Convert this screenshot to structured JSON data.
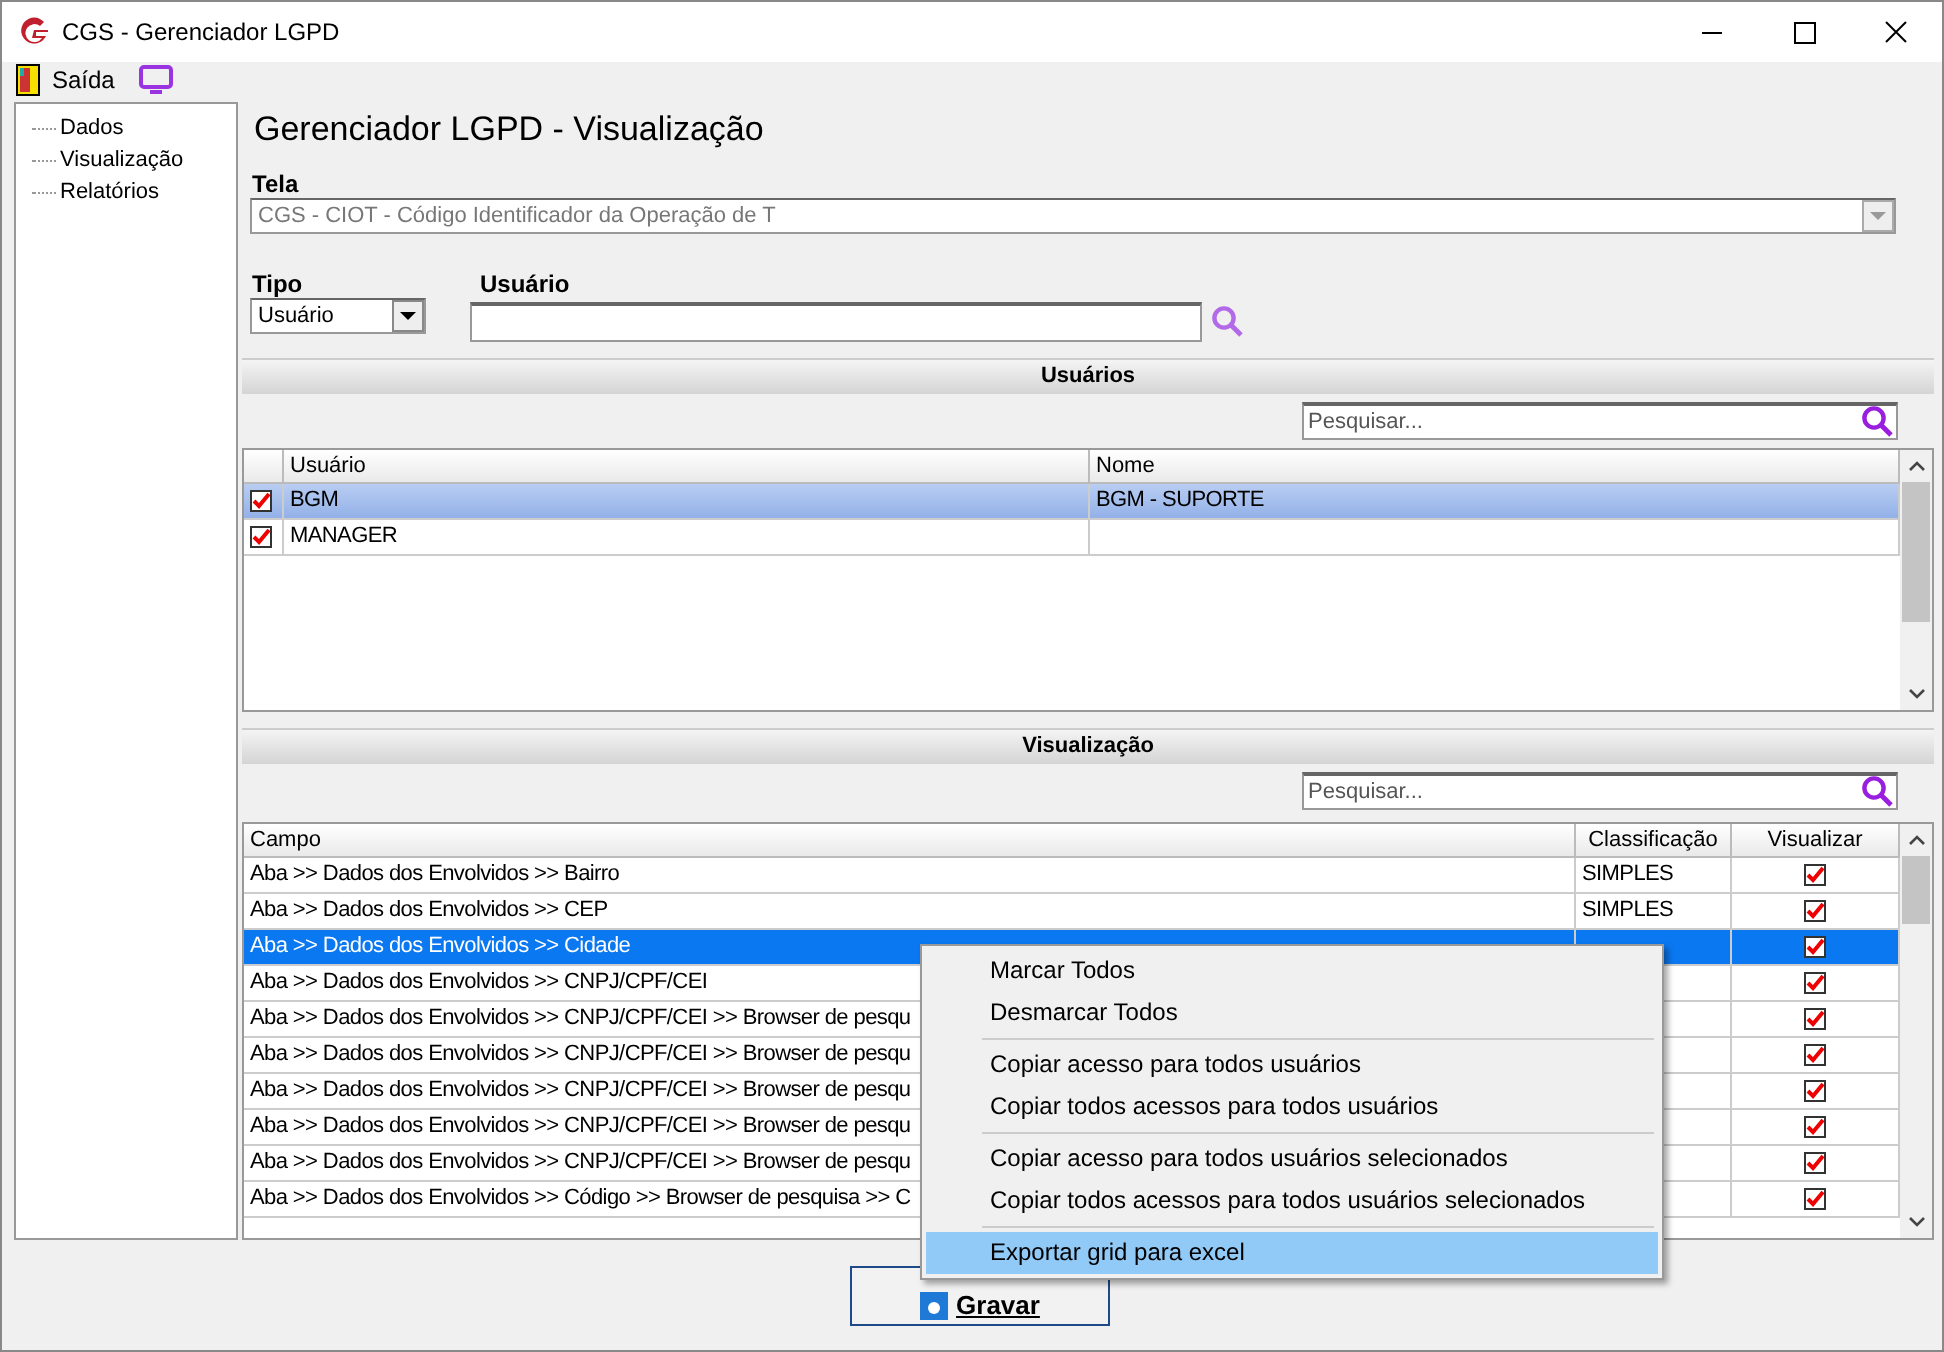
{
  "window": {
    "title": "CGS - Gerenciador LGPD"
  },
  "menu_bar": {
    "items": [
      {
        "label": "Saída"
      }
    ]
  },
  "sidebar": {
    "items": [
      {
        "label": "Dados"
      },
      {
        "label": "Visualização"
      },
      {
        "label": "Relatórios"
      }
    ]
  },
  "page_title": "Gerenciador LGPD - Visualização",
  "tela": {
    "label": "Tela",
    "value": "CGS - CIOT - Código Identificador da Operação de T",
    "disabled": true
  },
  "tipo": {
    "label": "Tipo",
    "value": "Usuário"
  },
  "usuario": {
    "label": "Usuário"
  },
  "users_section": {
    "title": "Usuários",
    "search_placeholder": "Pesquisar...",
    "columns": [
      "Usuário",
      "Nome"
    ],
    "rows": [
      {
        "user": "BGM",
        "name": "BGM - SUPORTE",
        "checked": true,
        "selected": true
      },
      {
        "user": "MANAGER",
        "name": "",
        "checked": true,
        "selected": false
      }
    ]
  },
  "view_section": {
    "title": "Visualização",
    "search_placeholder": "Pesquisar...",
    "columns": [
      "Campo",
      "Classificação",
      "Visualizar"
    ],
    "rows": [
      {
        "campo": "Aba >> Dados dos Envolvidos >> Bairro",
        "classificacao": "SIMPLES",
        "visualizar": true,
        "selected": false
      },
      {
        "campo": "Aba >> Dados dos Envolvidos >> CEP",
        "classificacao": "SIMPLES",
        "visualizar": true,
        "selected": false
      },
      {
        "campo": "Aba >> Dados dos Envolvidos >> Cidade",
        "visualizar": true,
        "selected": true
      },
      {
        "campo": "Aba >> Dados dos Envolvidos >> CNPJ/CPF/CEI",
        "visualizar": true,
        "selected": false
      },
      {
        "campo": "Aba >> Dados dos Envolvidos >> CNPJ/CPF/CEI >> Browser de pesqu",
        "visualizar": true,
        "selected": false
      },
      {
        "campo": "Aba >> Dados dos Envolvidos >> CNPJ/CPF/CEI >> Browser de pesqu",
        "visualizar": true,
        "selected": false
      },
      {
        "campo": "Aba >> Dados dos Envolvidos >> CNPJ/CPF/CEI >> Browser de pesqu",
        "visualizar": true,
        "selected": false
      },
      {
        "campo": "Aba >> Dados dos Envolvidos >> CNPJ/CPF/CEI >> Browser de pesqu",
        "visualizar": true,
        "selected": false
      },
      {
        "campo": "Aba >> Dados dos Envolvidos >> CNPJ/CPF/CEI >> Browser de pesqu",
        "visualizar": true,
        "selected": false
      },
      {
        "campo": "Aba >> Dados dos Envolvidos >> Código >> Browser de pesquisa >> C",
        "visualizar": true,
        "selected": false
      }
    ]
  },
  "save_button": {
    "label": "Gravar"
  },
  "context_menu": {
    "items": [
      {
        "kind": "item",
        "label": "Marcar Todos",
        "selected": false
      },
      {
        "kind": "item",
        "label": "Desmarcar Todos",
        "selected": false
      },
      {
        "kind": "separator"
      },
      {
        "kind": "item",
        "label": "Copiar acesso para todos usuários",
        "selected": false
      },
      {
        "kind": "item",
        "label": "Copiar todos acessos para todos usuários",
        "selected": false
      },
      {
        "kind": "separator"
      },
      {
        "kind": "item",
        "label": "Copiar acesso para todos usuários selecionados",
        "selected": false
      },
      {
        "kind": "item",
        "label": "Copiar todos acessos para todos usuários selecionados",
        "selected": false
      },
      {
        "kind": "separator"
      },
      {
        "kind": "item",
        "label": "Exportar grid para excel",
        "selected": true
      }
    ]
  }
}
